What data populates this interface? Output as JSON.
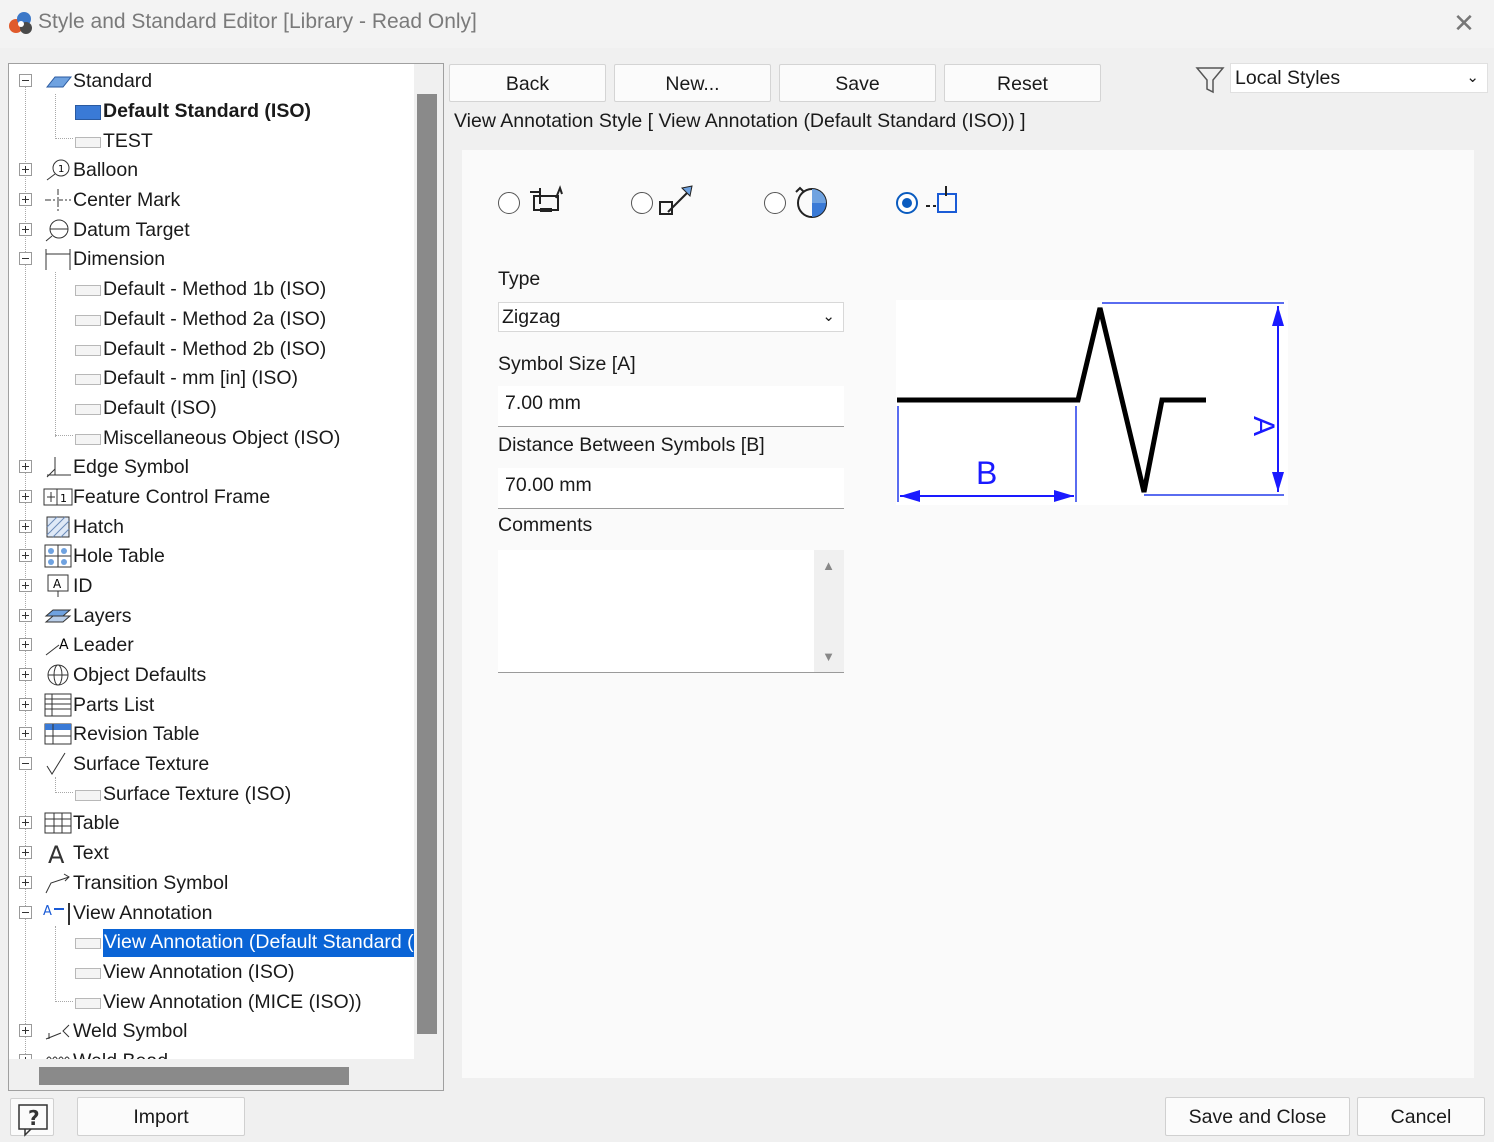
{
  "window": {
    "title": "Style and Standard Editor [Library - Read Only]",
    "close_glyph": "✕"
  },
  "toolbar": {
    "back": "Back",
    "new": "New...",
    "save": "Save",
    "reset": "Reset",
    "filter_value": "Local Styles"
  },
  "tree": {
    "standard": "Standard",
    "default_standard": "Default Standard (ISO)",
    "test": "TEST",
    "balloon": "Balloon",
    "center_mark": "Center Mark",
    "datum_target": "Datum Target",
    "dimension": "Dimension",
    "dim_1b": "Default - Method 1b (ISO)",
    "dim_2a": "Default - Method 2a (ISO)",
    "dim_2b": "Default - Method 2b (ISO)",
    "dim_mm": "Default - mm [in] (ISO)",
    "dim_iso": "Default (ISO)",
    "dim_misc": "Miscellaneous Object (ISO)",
    "edge_symbol": "Edge Symbol",
    "fcf": "Feature Control Frame",
    "hatch": "Hatch",
    "hole_table": "Hole Table",
    "id": "ID",
    "layers": "Layers",
    "leader": "Leader",
    "object_defaults": "Object Defaults",
    "parts_list": "Parts List",
    "revision_table": "Revision Table",
    "surface_texture": "Surface Texture",
    "surface_texture_iso": "Surface Texture (ISO)",
    "table": "Table",
    "text": "Text",
    "transition_symbol": "Transition Symbol",
    "view_annotation": "View Annotation",
    "va_default": "View Annotation (Default Standard (I",
    "va_iso": "View Annotation (ISO)",
    "va_mice": "View Annotation (MICE (ISO))",
    "weld_symbol": "Weld Symbol",
    "weld_bead": "Weld Bead"
  },
  "editor": {
    "header": "View Annotation Style [ View Annotation (Default Standard (ISO)) ]",
    "type_label": "Type",
    "type_value": "Zigzag",
    "symbol_size_label": "Symbol Size [A]",
    "symbol_size_value": "7.00 mm",
    "distance_label": "Distance Between Symbols [B]",
    "distance_value": "70.00 mm",
    "comments_label": "Comments",
    "comments_value": "",
    "preview_label_a": "A",
    "preview_label_b": "B"
  },
  "footer": {
    "import": "Import",
    "save_and_close": "Save and Close",
    "cancel": "Cancel"
  },
  "colors": {
    "accent": "#0a5bbf",
    "selection": "#0a64d6",
    "dimension_blue": "#1a1aff"
  }
}
